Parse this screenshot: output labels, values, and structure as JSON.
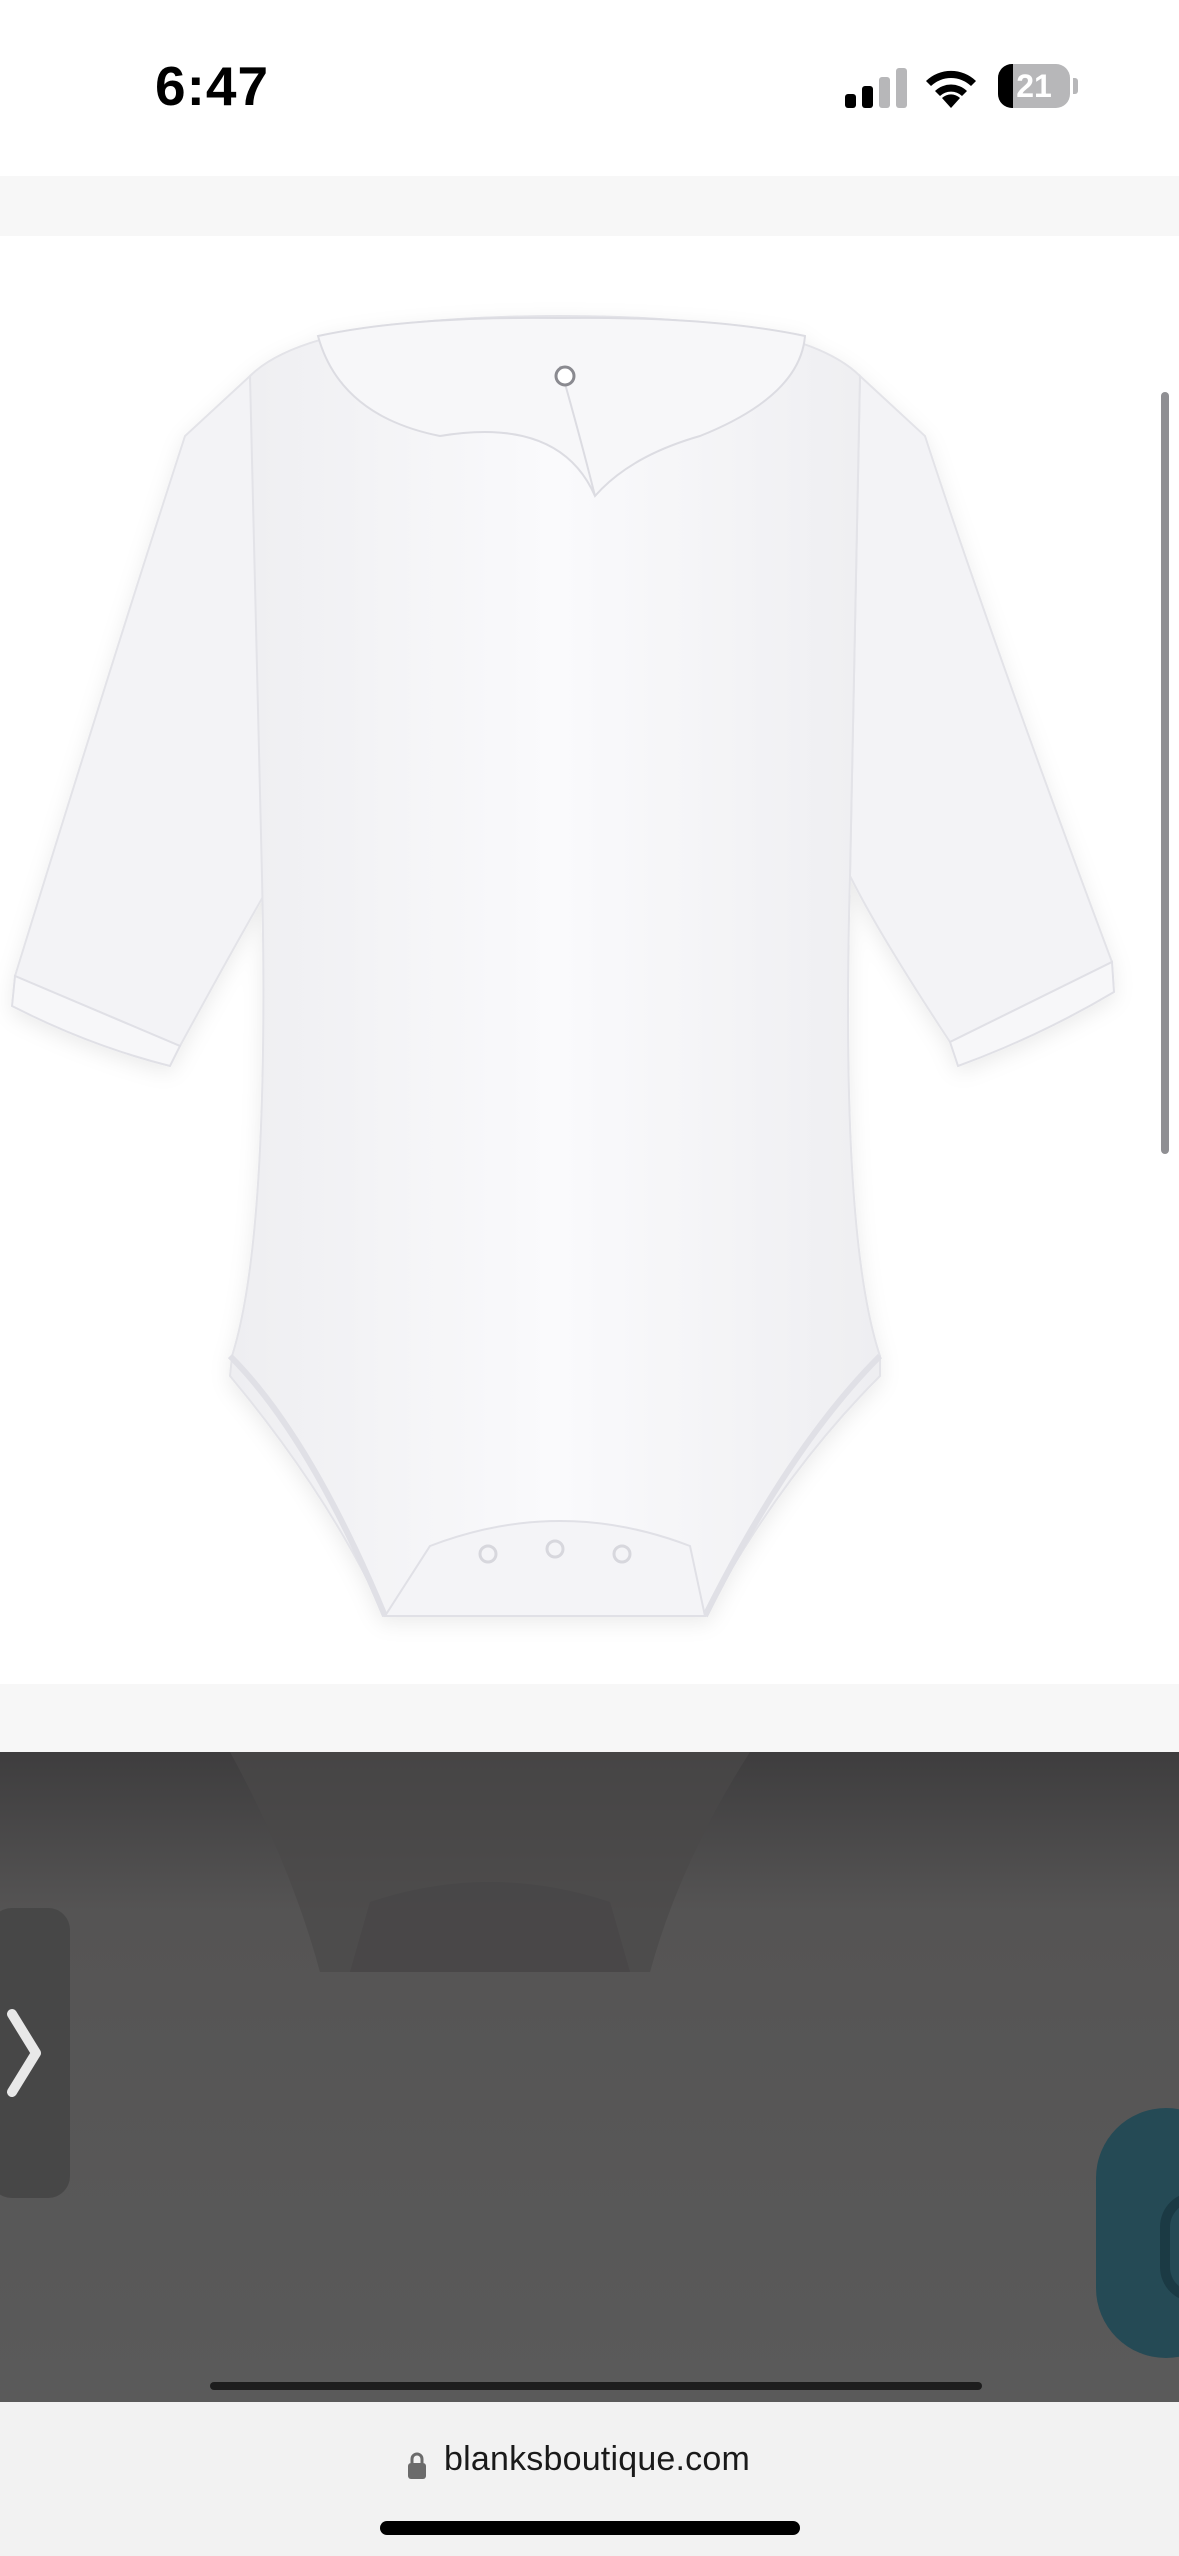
{
  "status_bar": {
    "time": "6:47",
    "battery_level": "21",
    "battery_fraction": 0.21,
    "signal_bars_active": 2,
    "signal_bars_total": 4,
    "icons": [
      "cellular-signal-icon",
      "wifi-icon",
      "battery-icon"
    ]
  },
  "product_image": {
    "subject": "white long-sleeve baby bodysuit with peter pan collar",
    "background_color": "#ffffff"
  },
  "carousel": {
    "next_arrow_icon": "chevron-right-icon"
  },
  "chat": {
    "accent_color": "#254a55"
  },
  "browser": {
    "url": "blanksboutique.com",
    "secure_icon": "lock-icon"
  }
}
